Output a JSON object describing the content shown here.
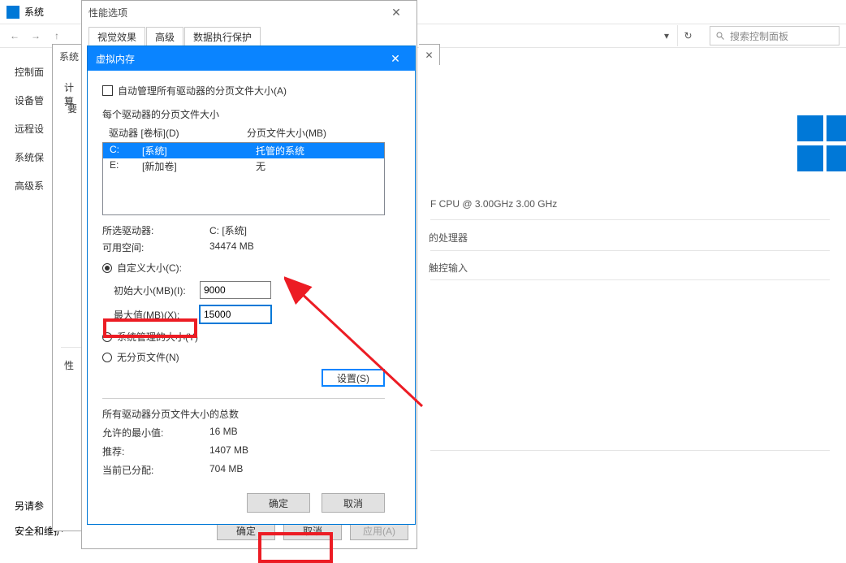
{
  "topbar": {
    "title": "系统"
  },
  "toolbar": {
    "search_placeholder": "搜索控制面板"
  },
  "sidebar": {
    "items": [
      "控制面",
      "设备管",
      "远程设",
      "系统保",
      "高级系"
    ]
  },
  "bg": {
    "cpu": "F CPU @ 3.00GHz  3.00 GHz",
    "proc": "的处理器",
    "touch": "触控输入"
  },
  "bottom_left": {
    "line1": "另请参",
    "line2": "安全和维护"
  },
  "sys_strip": {
    "title": "系统",
    "row1": "计算",
    "row2": "要",
    "row3": "性"
  },
  "perf": {
    "title": "性能选项",
    "tabs": [
      "视觉效果",
      "高级",
      "数据执行保护"
    ],
    "ok": "确定",
    "cancel": "取消",
    "apply": "应用(A)"
  },
  "vm": {
    "title": "虚拟内存",
    "auto_label": "自动管理所有驱动器的分页文件大小(A)",
    "per_drive_label": "每个驱动器的分页文件大小",
    "col_drive": "驱动器 [卷标](D)",
    "col_size": "分页文件大小(MB)",
    "drives": [
      {
        "letter": "C:",
        "label": "[系统]",
        "size": "托管的系统",
        "selected": true
      },
      {
        "letter": "E:",
        "label": "[新加卷]",
        "size": "无",
        "selected": false
      }
    ],
    "selected_drive_label": "所选驱动器:",
    "selected_drive_value": "C:    [系统]",
    "free_label": "可用空间:",
    "free_value": "34474 MB",
    "custom_label": "自定义大小(C):",
    "initial_label": "初始大小(MB)(I):",
    "initial_value": "9000",
    "max_label": "最大值(MB)(X):",
    "max_value": "15000",
    "sysmanaged_label": "系统管理的大小(Y)",
    "nopage_label": "无分页文件(N)",
    "set_btn": "设置(S)",
    "totals_label": "所有驱动器分页文件大小的总数",
    "min_label": "允许的最小值:",
    "min_value": "16 MB",
    "rec_label": "推荐:",
    "rec_value": "1407 MB",
    "cur_label": "当前已分配:",
    "cur_value": "704 MB",
    "ok": "确定",
    "cancel": "取消"
  }
}
